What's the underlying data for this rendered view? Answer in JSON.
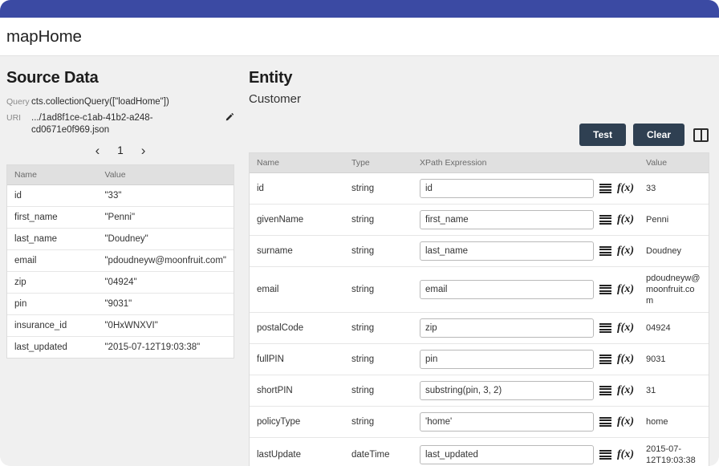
{
  "window": {
    "accent_color": "#3b4aa3",
    "app_title": "mapHome"
  },
  "source_panel": {
    "title": "Source Data",
    "query_label": "Query",
    "query_value": "cts.collectionQuery([\"loadHome\"])",
    "uri_label": "URI",
    "uri_value": ".../1ad8f1ce-c1ab-41b2-a248-cd0671e0f969.json",
    "edit_icon": "pencil-icon",
    "pager": {
      "prev_icon": "chevron-left-icon",
      "next_icon": "chevron-right-icon",
      "page": "1"
    },
    "columns": [
      "Name",
      "Value"
    ],
    "rows": [
      {
        "name": "id",
        "value": "\"33\""
      },
      {
        "name": "first_name",
        "value": "\"Penni\""
      },
      {
        "name": "last_name",
        "value": "\"Doudney\""
      },
      {
        "name": "email",
        "value": "\"pdoudneyw@moonfruit.com\""
      },
      {
        "name": "zip",
        "value": "\"04924\""
      },
      {
        "name": "pin",
        "value": "\"9031\""
      },
      {
        "name": "insurance_id",
        "value": "\"0HxWNXVI\""
      },
      {
        "name": "last_updated",
        "value": "\"2015-07-12T19:03:38\""
      }
    ]
  },
  "entity_panel": {
    "title": "Entity",
    "subtitle": "Customer",
    "toolbar": {
      "test_label": "Test",
      "clear_label": "Clear",
      "split_icon": "split-pane-icon",
      "button_color": "#2f4052"
    },
    "columns": [
      "Name",
      "Type",
      "XPath Expression",
      "Value"
    ],
    "rows": [
      {
        "name": "id",
        "type": "string",
        "xpath": "id",
        "value": "33"
      },
      {
        "name": "givenName",
        "type": "string",
        "xpath": "first_name",
        "value": "Penni"
      },
      {
        "name": "surname",
        "type": "string",
        "xpath": "last_name",
        "value": "Doudney"
      },
      {
        "name": "email",
        "type": "string",
        "xpath": "email",
        "value": "pdoudneyw@moonfruit.com"
      },
      {
        "name": "postalCode",
        "type": "string",
        "xpath": "zip",
        "value": "04924"
      },
      {
        "name": "fullPIN",
        "type": "string",
        "xpath": "pin",
        "value": "9031"
      },
      {
        "name": "shortPIN",
        "type": "string",
        "xpath": "substring(pin, 3, 2)",
        "value": "31"
      },
      {
        "name": "policyType",
        "type": "string",
        "xpath": "'home'",
        "value": "home"
      },
      {
        "name": "lastUpdate",
        "type": "dateTime",
        "xpath": "last_updated",
        "value": "2015-07-12T19:03:38"
      }
    ],
    "row_icons": {
      "list": "list-icon",
      "function": "fx-icon"
    }
  }
}
